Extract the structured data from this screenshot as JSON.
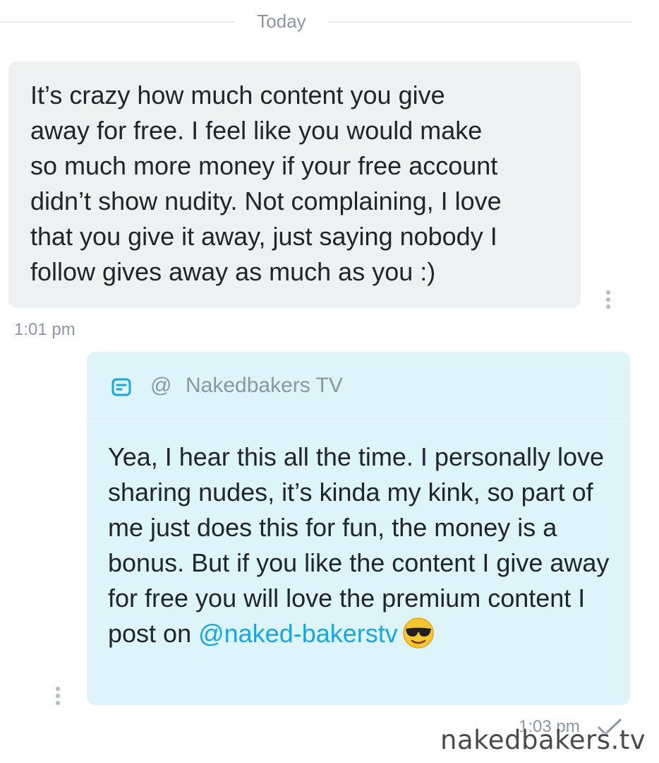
{
  "divider": {
    "label": "Today"
  },
  "incoming": {
    "text": "It’s crazy how much content you give\naway for free. I feel like you would make\nso much more money if your free account\ndidn’t show nudity. Not complaining, I love\nthat you give it away, just saying nobody I\nfollow gives away as much as you :)",
    "time": "1:01 pm",
    "more_icon": "more-vertical-icon"
  },
  "outgoing": {
    "quote": {
      "icon": "note-icon",
      "at": "@",
      "name": "Nakedbakers TV"
    },
    "text_main": "Yea, I hear this all the time. I personally love sharing nudes, it’s kinda my kink, so part of me just does this for fun, the money is a bonus. But if you like the content I give away for free you will love the premium content I post on ",
    "mention": "@naked-bakerstv",
    "emoji": "smiling-face-with-sunglasses",
    "time": "1:03 pm",
    "status_icon": "check-icon",
    "more_icon": "more-vertical-icon"
  },
  "colors": {
    "incoming_bubble": "#eef1f2",
    "outgoing_bubble": "#def4fb",
    "mention": "#1aa6dc",
    "meta_text": "#8a96a3"
  },
  "watermark": "nakedbakers.tv"
}
